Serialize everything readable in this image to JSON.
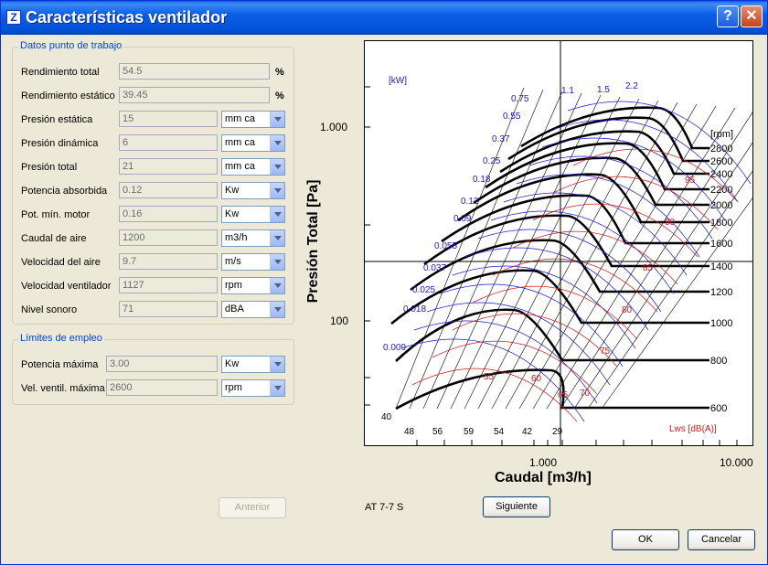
{
  "window": {
    "title": "Características ventilador"
  },
  "work_point": {
    "title": "Datos punto de trabajo",
    "rows": [
      {
        "label": "Rendimiento total",
        "value": "54.5",
        "unit": "%",
        "type": "pct"
      },
      {
        "label": "Rendimiento estático",
        "value": "39.45",
        "unit": "%",
        "type": "pct"
      },
      {
        "label": "Presión estática",
        "value": "15",
        "unit": "mm ca",
        "type": "combo"
      },
      {
        "label": "Presión dinámica",
        "value": "6",
        "unit": "mm ca",
        "type": "combo"
      },
      {
        "label": "Presión total",
        "value": "21",
        "unit": "mm ca",
        "type": "combo"
      },
      {
        "label": "Potencia absorbida",
        "value": "0.12",
        "unit": "Kw",
        "type": "combo"
      },
      {
        "label": "Pot. mín. motor",
        "value": "0.16",
        "unit": "Kw",
        "type": "combo"
      },
      {
        "label": "Caudal de aire",
        "value": "1200",
        "unit": "m3/h",
        "type": "combo"
      },
      {
        "label": "Velocidad del aire",
        "value": "9.7",
        "unit": "m/s",
        "type": "combo"
      },
      {
        "label": "Velocidad ventilador",
        "value": "1127",
        "unit": "rpm",
        "type": "combo"
      },
      {
        "label": "Nivel sonoro",
        "value": "71",
        "unit": "dBA",
        "type": "combo"
      }
    ]
  },
  "limits": {
    "title": "Límites de empleo",
    "rows": [
      {
        "label": "Potencia máxima",
        "value": "3.00",
        "unit": "Kw"
      },
      {
        "label": "Vel. ventil. máxima",
        "value": "2600",
        "unit": "rpm"
      }
    ]
  },
  "chart_data": {
    "type": "line",
    "xlabel": "Caudal [m3/h]",
    "ylabel": "Presión Total [Pa]",
    "x_scale": "log",
    "y_scale": "log",
    "x_ticks": [
      "1.000",
      "10.000"
    ],
    "y_ticks": [
      "1.000",
      "100"
    ],
    "operating_point": {
      "x": 1200,
      "y": 206
    },
    "rpm_unit_label": "[rpm]",
    "rpm_curves": [
      "2800",
      "2600",
      "2400",
      "2200",
      "2000",
      "1800",
      "1600",
      "1400",
      "1200",
      "1000",
      "800",
      "600"
    ],
    "power_unit_label": "[kW]",
    "power_labels": [
      "0.75",
      "0.55",
      "0.37",
      "0.25",
      "0.18",
      "0.12",
      "0.09",
      "0.055",
      "0.037",
      "0.025",
      "0.018",
      "0.009",
      "1.1",
      "1.5",
      "2.2"
    ],
    "sound_unit_label": "Lws [dB(A)]",
    "sound_labels": [
      "95",
      "90",
      "85",
      "80",
      "75",
      "70",
      "65",
      "60",
      "55"
    ],
    "efficiency_labels": [
      "40",
      "48",
      "56",
      "59",
      "54",
      "42",
      "29"
    ]
  },
  "footer": {
    "prev_label": "Anterior",
    "model": "AT 7-7 S",
    "next_label": "Siguiente",
    "ok_label": "OK",
    "cancel_label": "Cancelar"
  }
}
